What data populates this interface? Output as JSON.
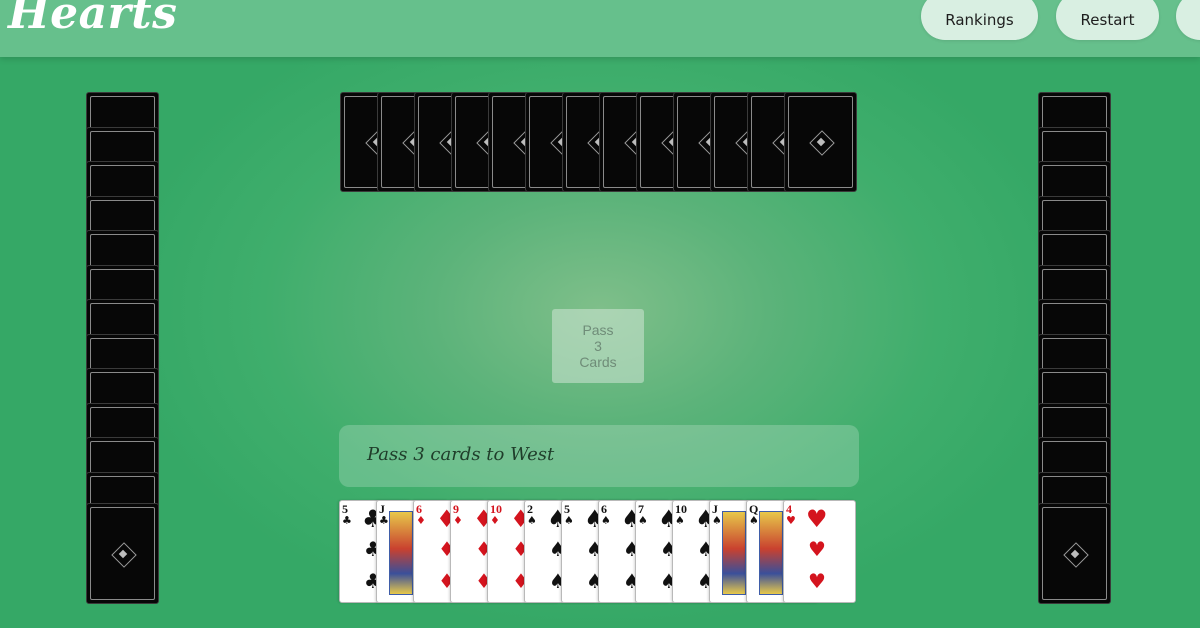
{
  "app": {
    "logo": "Hearts"
  },
  "header": {
    "buttons": [
      {
        "label": "Rankings"
      },
      {
        "label": "Restart"
      },
      {
        "label": ""
      }
    ]
  },
  "center": {
    "pass_button_lines": [
      "Pass",
      "3",
      "Cards"
    ]
  },
  "status": {
    "message": "Pass 3 cards to West"
  },
  "opponents": {
    "west_card_count": 13,
    "north_card_count": 13,
    "east_card_count": 13
  },
  "hand": [
    {
      "rank": "5",
      "suit": "♣",
      "color": "black"
    },
    {
      "rank": "J",
      "suit": "♣",
      "color": "black",
      "face": true
    },
    {
      "rank": "6",
      "suit": "♦",
      "color": "red"
    },
    {
      "rank": "9",
      "suit": "♦",
      "color": "red"
    },
    {
      "rank": "10",
      "suit": "♦",
      "color": "red"
    },
    {
      "rank": "2",
      "suit": "♠",
      "color": "black"
    },
    {
      "rank": "5",
      "suit": "♠",
      "color": "black"
    },
    {
      "rank": "6",
      "suit": "♠",
      "color": "black"
    },
    {
      "rank": "7",
      "suit": "♠",
      "color": "black"
    },
    {
      "rank": "10",
      "suit": "♠",
      "color": "black"
    },
    {
      "rank": "J",
      "suit": "♠",
      "color": "black",
      "face": true
    },
    {
      "rank": "Q",
      "suit": "♠",
      "color": "black",
      "face": true
    },
    {
      "rank": "4",
      "suit": "♥",
      "color": "red"
    }
  ],
  "colors": {
    "felt": "#3fae6c",
    "topbar": "#66c08c",
    "button_bg": "#d9efe2",
    "card_back": "#070707",
    "red_suit": "#d4141e"
  }
}
